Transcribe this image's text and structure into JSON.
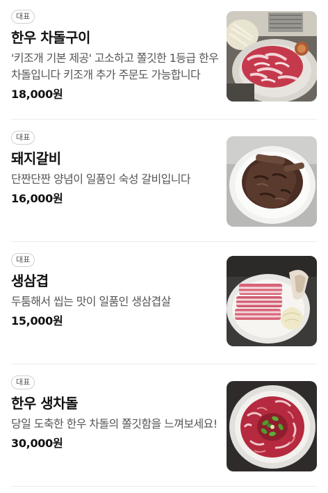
{
  "menu": {
    "items": [
      {
        "badge": "대표",
        "name": "한우 차돌구이",
        "description": "'키조개 기본 제공' 고소하고 쫄깃한 1등급 한우 차돌입니다 키조개 추가 주문도 가능합니다",
        "price": "18,000원",
        "image": "grilled-brisket-photo"
      },
      {
        "badge": "대표",
        "name": "돼지갈비",
        "description": "단짠단짠 양념이 일품인 숙성 갈비입니다",
        "price": "16,000원",
        "image": "pork-ribs-photo"
      },
      {
        "badge": "대표",
        "name": "생삼겹",
        "description": "두툼해서 씹는 맛이 일품인 생삼겹살",
        "price": "15,000원",
        "image": "pork-belly-photo"
      },
      {
        "badge": "대표",
        "name": "한우 생차돌",
        "description": "당일 도축한 한우 차돌의 쫄깃함을 느껴보세요!",
        "price": "30,000원",
        "image": "raw-brisket-photo"
      }
    ]
  }
}
